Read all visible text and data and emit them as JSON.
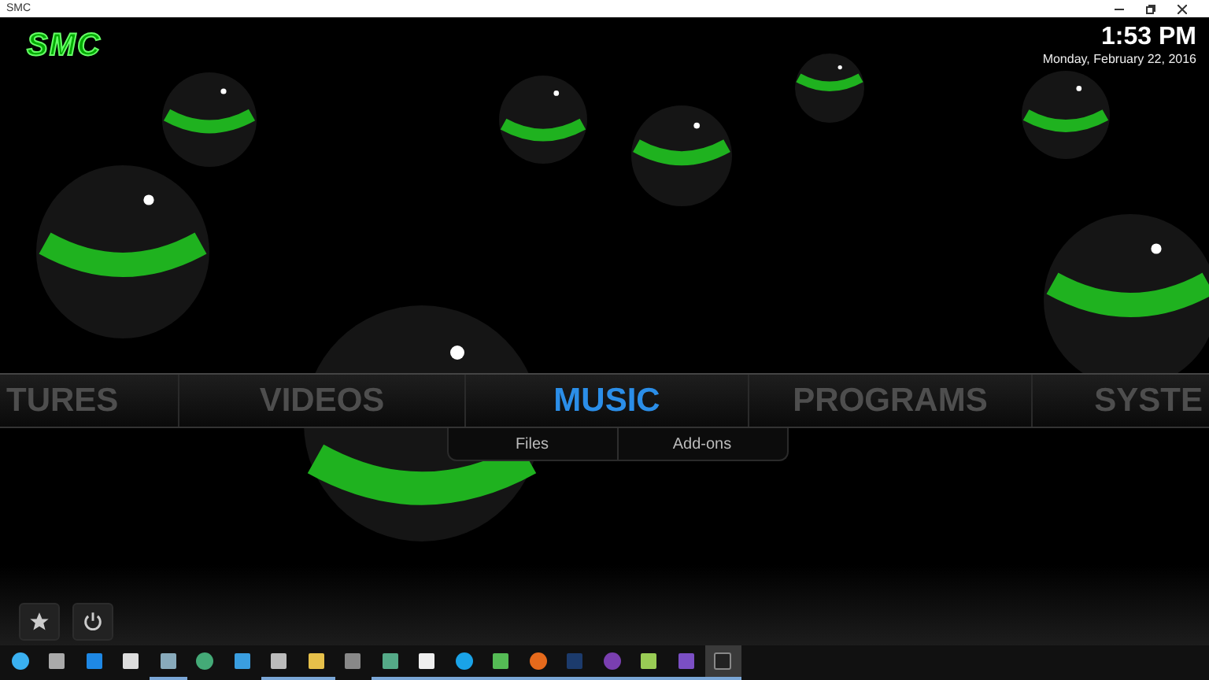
{
  "window": {
    "title": "SMC"
  },
  "logo": {
    "text": "SMC"
  },
  "clock": {
    "time": "1:53 PM",
    "date": "Monday, February 22, 2016"
  },
  "main_menu": [
    {
      "label": "TURES",
      "selected": false
    },
    {
      "label": "VIDEOS",
      "selected": false
    },
    {
      "label": "MUSIC",
      "selected": true
    },
    {
      "label": "PROGRAMS",
      "selected": false
    },
    {
      "label": "SYSTE",
      "selected": false
    }
  ],
  "submenu": [
    "Files",
    "Add-ons"
  ],
  "taskbar_items": [
    {
      "kind": "start",
      "running": false
    },
    {
      "kind": "taskview",
      "running": false
    },
    {
      "kind": "edge",
      "running": false
    },
    {
      "kind": "store",
      "running": false
    },
    {
      "kind": "doc",
      "running": true
    },
    {
      "kind": "circle",
      "running": false
    },
    {
      "kind": "ie",
      "running": false
    },
    {
      "kind": "printer",
      "running": true
    },
    {
      "kind": "folder",
      "running": true
    },
    {
      "kind": "square",
      "running": false
    },
    {
      "kind": "network",
      "running": true
    },
    {
      "kind": "letter",
      "running": true
    },
    {
      "kind": "skype",
      "running": true
    },
    {
      "kind": "greenletter",
      "running": true
    },
    {
      "kind": "firefox",
      "running": true
    },
    {
      "kind": "ps",
      "running": true
    },
    {
      "kind": "purple",
      "running": true
    },
    {
      "kind": "notepad",
      "running": true
    },
    {
      "kind": "vs",
      "running": true
    },
    {
      "kind": "active",
      "running": true
    }
  ]
}
